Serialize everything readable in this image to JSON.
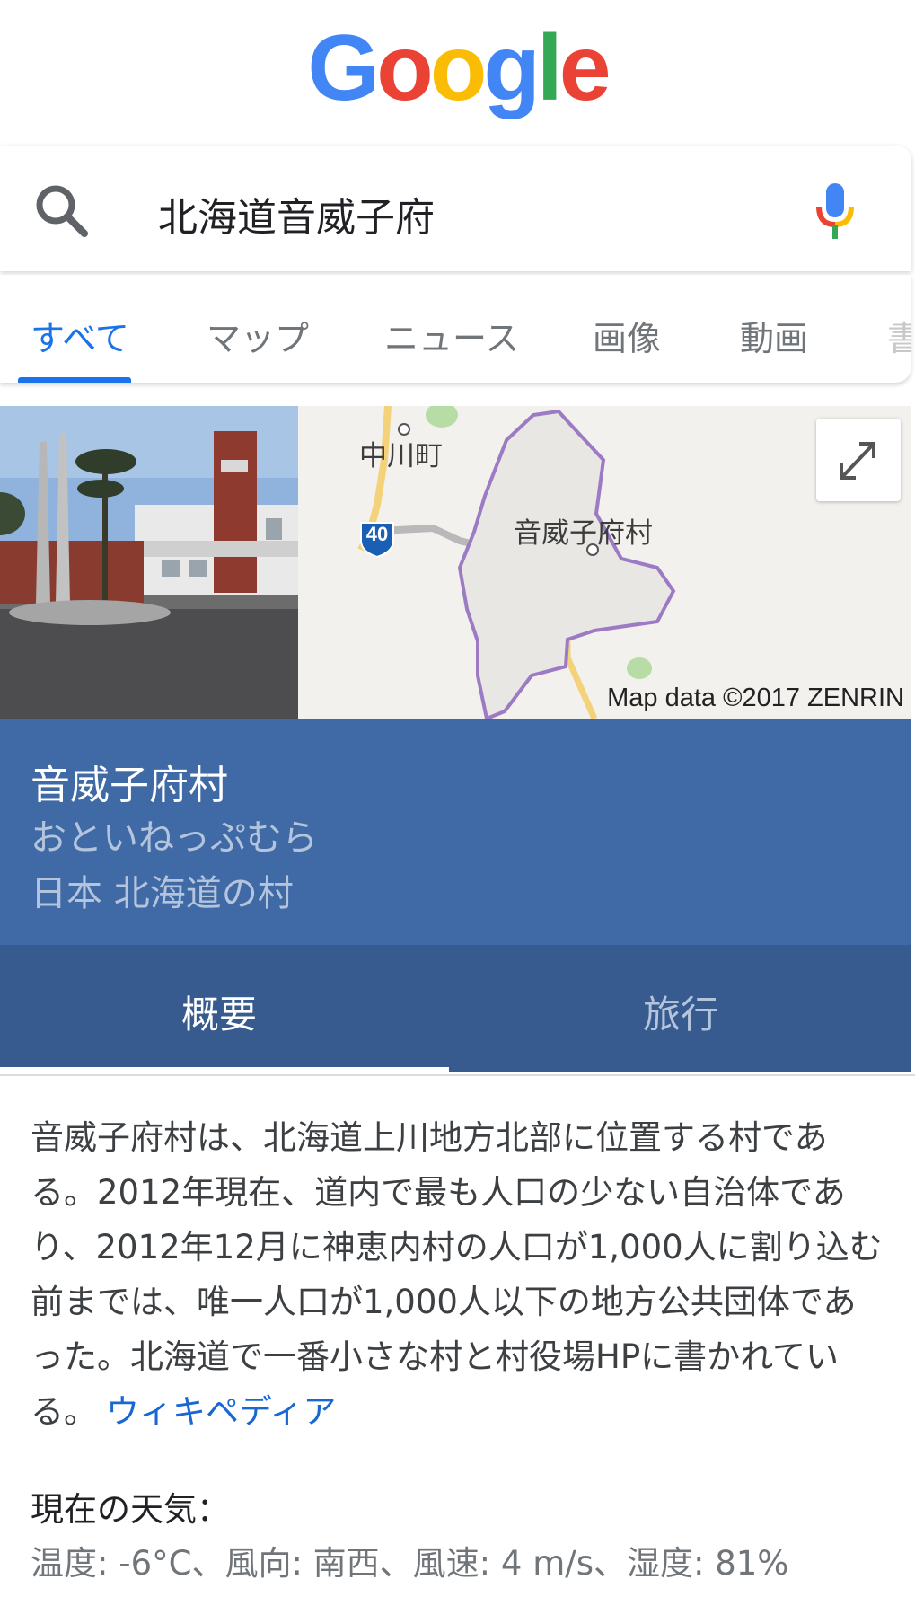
{
  "logo": {
    "letters": [
      {
        "ch": "G",
        "color": "#4285F4"
      },
      {
        "ch": "o",
        "color": "#EA4335"
      },
      {
        "ch": "o",
        "color": "#FBBC05"
      },
      {
        "ch": "g",
        "color": "#4285F4"
      },
      {
        "ch": "l",
        "color": "#34A853"
      },
      {
        "ch": "e",
        "color": "#EA4335"
      }
    ]
  },
  "search": {
    "query": "北海道音威子府"
  },
  "tabs": [
    {
      "label": "すべて",
      "active": true
    },
    {
      "label": "マップ"
    },
    {
      "label": "ニュース"
    },
    {
      "label": "画像"
    },
    {
      "label": "動画"
    },
    {
      "label": "書"
    }
  ],
  "map": {
    "label_town": "中川町",
    "label_village": "音威子府村",
    "route_number": "40",
    "credit": "Map data ©2017 ZENRIN"
  },
  "entity": {
    "title": "音威子府村",
    "reading": "おといねっぷむら",
    "type": "日本 北海道の村"
  },
  "entity_tabs": [
    {
      "label": "概要",
      "active": true
    },
    {
      "label": "旅行"
    }
  ],
  "description": {
    "text": "音威子府村は、北海道上川地方北部に位置する村である。2012年現在、道内で最も人口の少ない自治体であり、2012年12月に神恵内村の人口が1,000人に割り込む前までは、唯一人口が1,000人以下の地方公共団体であった。北海道で一番小さな村と村役場HPに書かれている。",
    "link": "ウィキペディア"
  },
  "weather": {
    "heading": "現在の天気：",
    "value": "温度: -6°C、風向: 南西、風速: 4 m/s、湿度: 81%"
  },
  "colors": {
    "accent": "#1a73e8",
    "infobox_bg": "#3f6aa5",
    "infotabs_bg": "#375b8f"
  }
}
